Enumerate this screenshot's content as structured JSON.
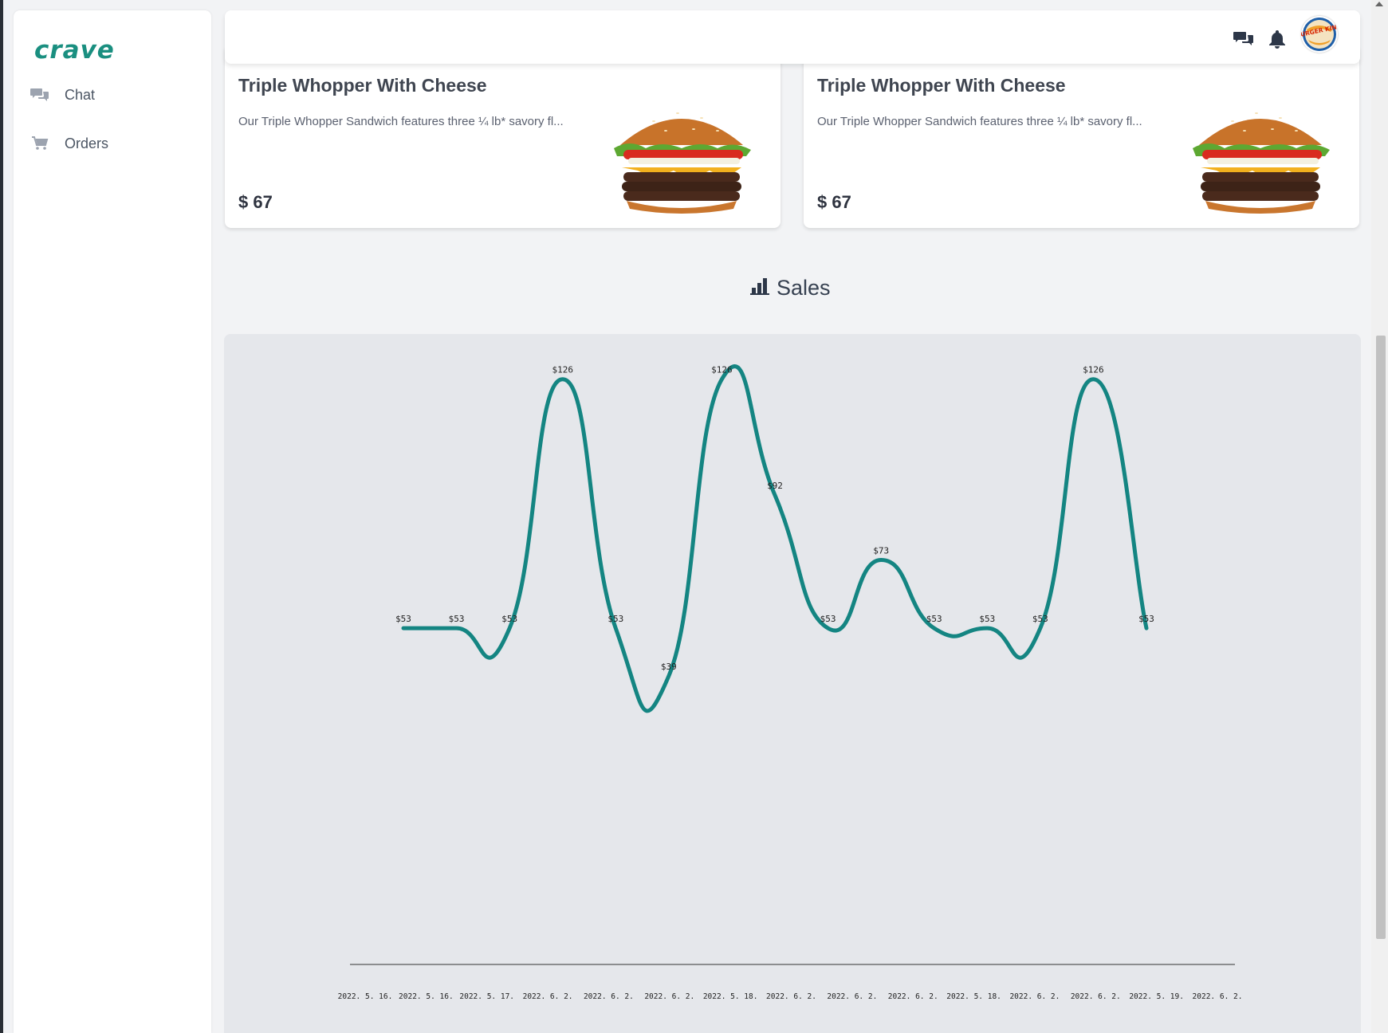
{
  "app": {
    "logo_text": "crave",
    "brand_color": "#1a8f80"
  },
  "sidebar": {
    "items": [
      {
        "label": "Chat",
        "icon": "chat-bubbles-icon"
      },
      {
        "label": "Orders",
        "icon": "cart-icon"
      }
    ]
  },
  "topbar": {
    "icons": [
      "chat-bubbles-icon",
      "bell-icon"
    ],
    "avatar": {
      "label": "BURGER KING"
    }
  },
  "products": [
    {
      "title": "Triple Whopper With Cheese",
      "description": "Our Triple Whopper Sandwich features three ¼ lb* savory fl...",
      "price": "$ 67"
    },
    {
      "title": "Triple Whopper With Cheese",
      "description": "Our Triple Whopper Sandwich features three ¼ lb* savory fl...",
      "price": "$ 67"
    }
  ],
  "sales": {
    "heading": "Sales",
    "icon": "bar-chart-icon"
  },
  "chart_data": {
    "type": "line",
    "line_color": "#148582",
    "x": [
      "2022. 5. 16.",
      "2022. 5. 16.",
      "2022. 5. 17.",
      "2022. 6. 2.",
      "2022. 6. 2.",
      "2022. 6. 2.",
      "2022. 5. 18.",
      "2022. 6. 2.",
      "2022. 6. 2.",
      "2022. 6. 2.",
      "2022. 5. 18.",
      "2022. 6. 2.",
      "2022. 6. 2.",
      "2022. 5. 19.",
      "2022. 6. 2."
    ],
    "values": [
      53,
      53,
      53,
      126,
      53,
      39,
      126,
      92,
      53,
      73,
      53,
      53,
      53,
      126,
      53
    ],
    "labels": [
      "$53",
      "$53",
      "$53",
      "$126",
      "$53",
      "$39",
      "$126",
      "$92",
      "$53",
      "$73",
      "$53",
      "$53",
      "$53",
      "$126",
      "$53"
    ],
    "grid": false,
    "legend": "none"
  }
}
